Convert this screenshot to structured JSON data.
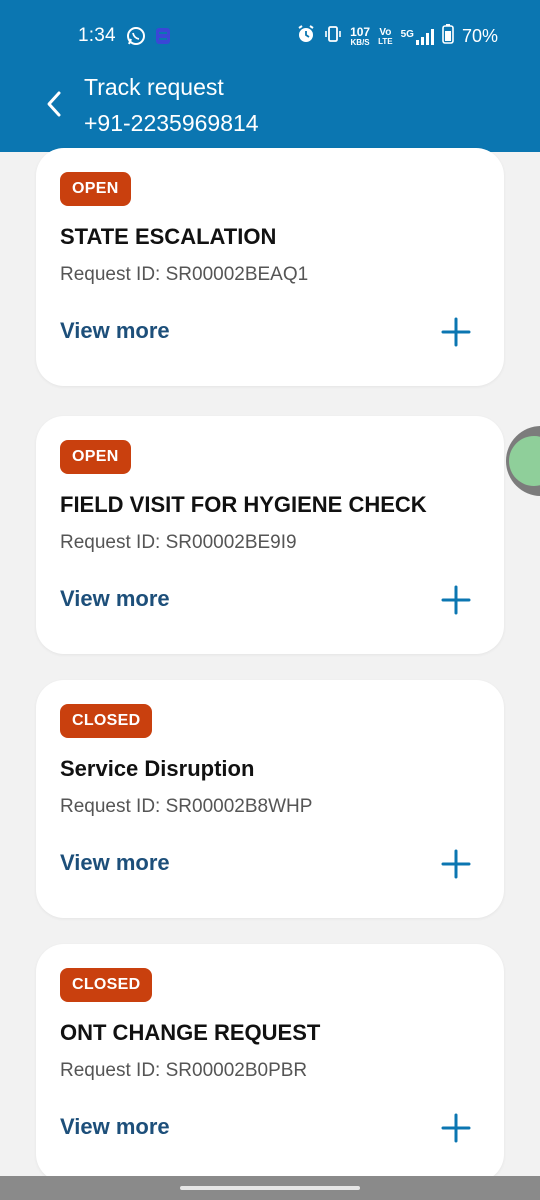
{
  "status_bar": {
    "time": "1:34",
    "speed_value": "107",
    "speed_unit": "KB/S",
    "volte_top": "Vo",
    "volte_bottom": "LTE",
    "network": "5G",
    "battery": "70%"
  },
  "header": {
    "title": "Track request",
    "subtitle": "+91-2235969814"
  },
  "requests": [
    {
      "status": "OPEN",
      "title": "STATE ESCALATION",
      "request_id": "Request ID: SR00002BEAQ1",
      "action": "View more"
    },
    {
      "status": "OPEN",
      "title": "FIELD VISIT FOR HYGIENE CHECK",
      "request_id": "Request ID: SR00002BE9I9",
      "action": "View more"
    },
    {
      "status": "CLOSED",
      "title": "Service Disruption",
      "request_id": "Request ID: SR00002B8WHP",
      "action": "View more"
    },
    {
      "status": "CLOSED",
      "title": "ONT CHANGE REQUEST",
      "request_id": "Request ID: SR00002B0PBR",
      "action": "View more"
    }
  ],
  "colors": {
    "header_blue": "#0b76b1",
    "badge_orange": "#c9400e",
    "link_blue": "#1d4f7a"
  }
}
